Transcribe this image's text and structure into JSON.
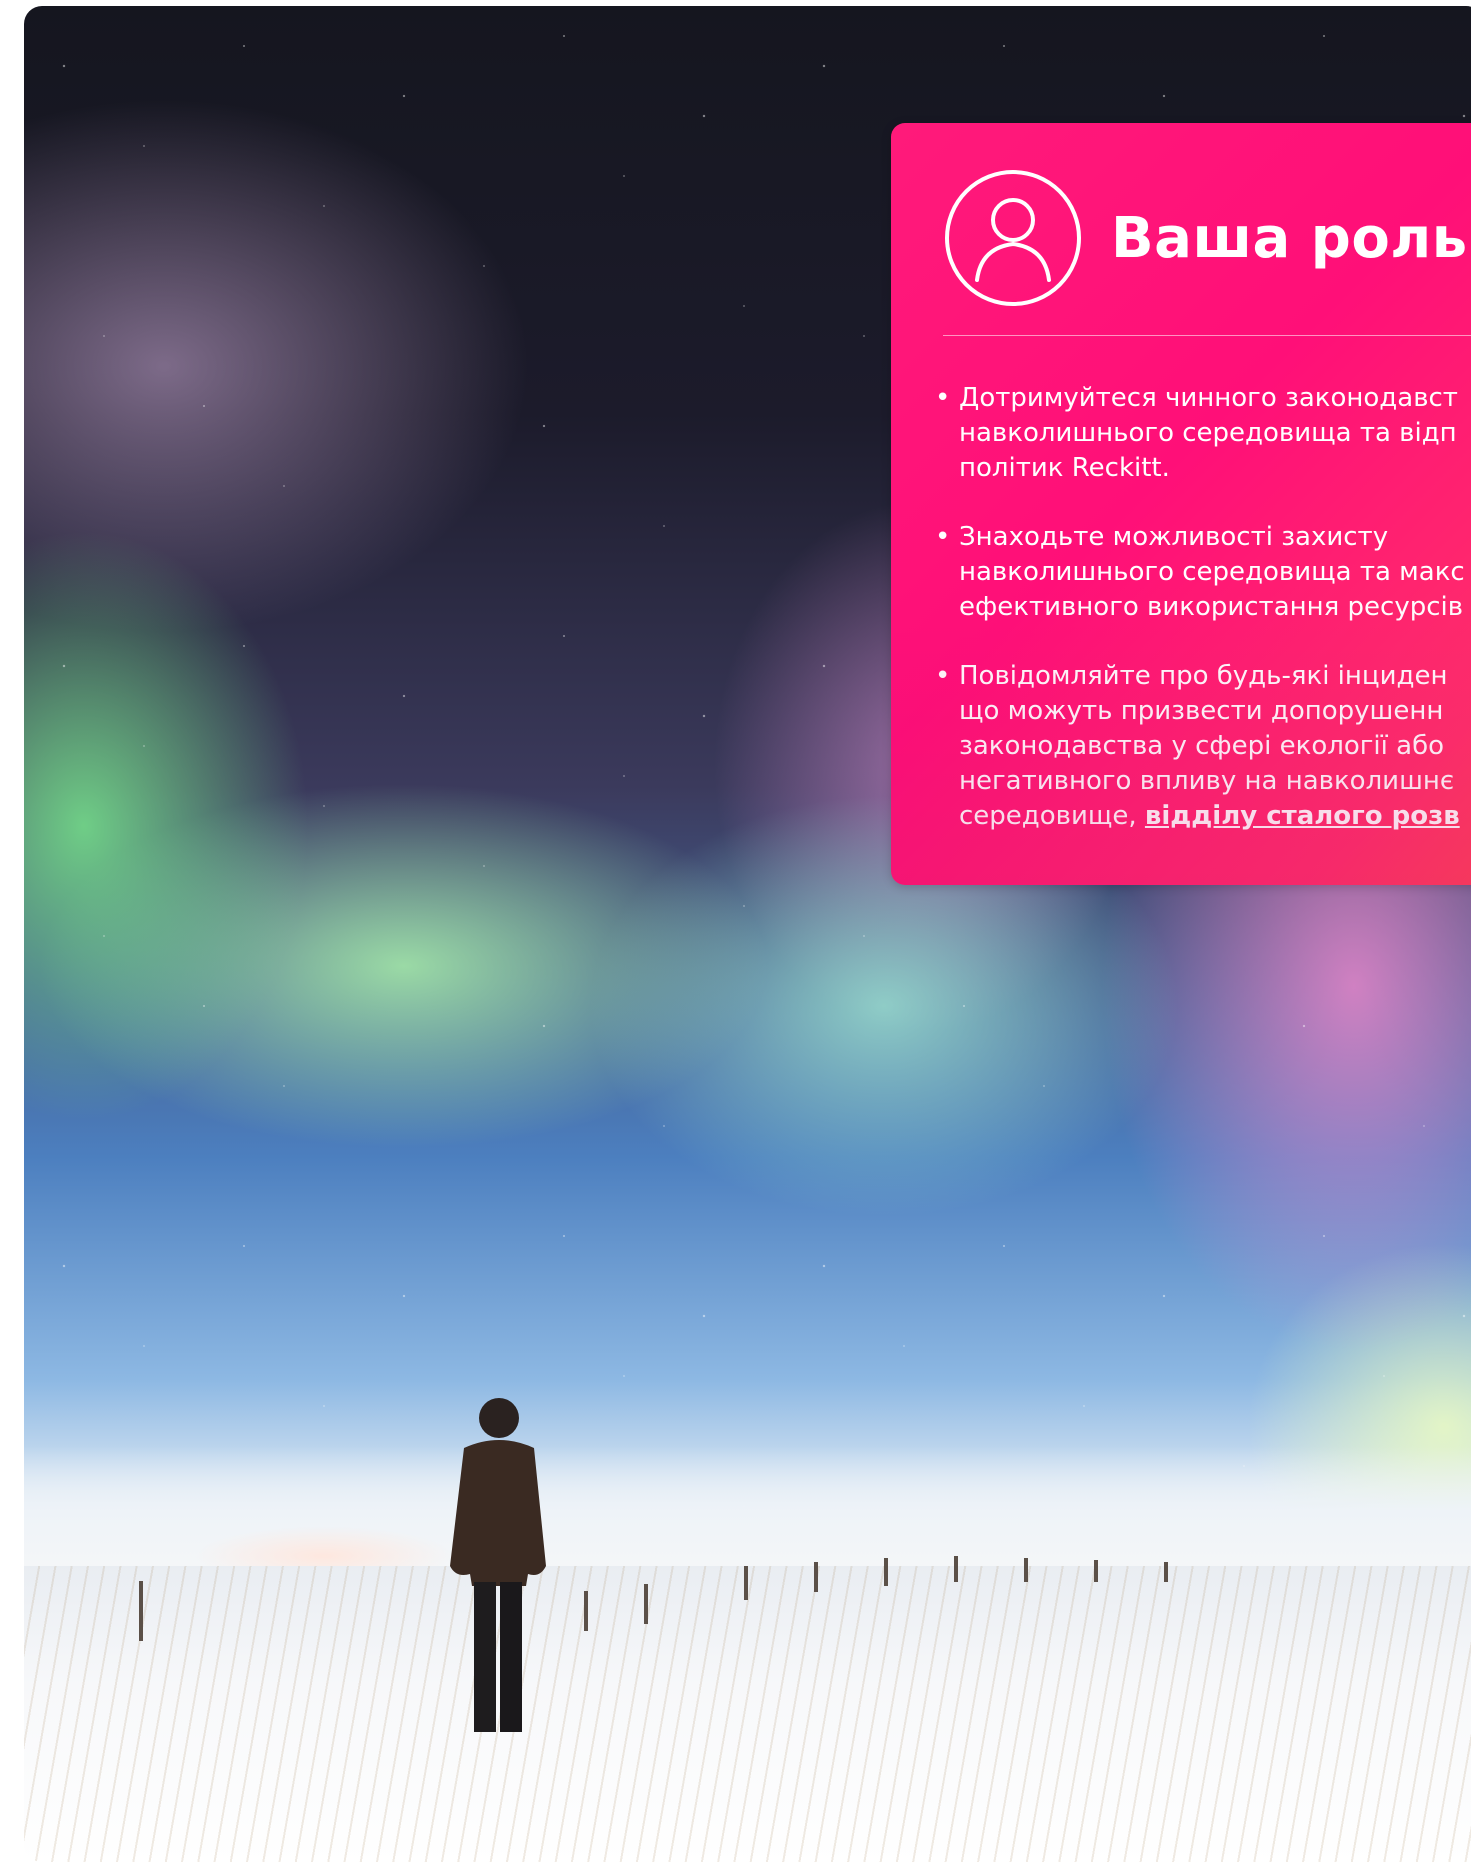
{
  "role_card": {
    "title": "Ваша роль",
    "icon": "user-outline-icon",
    "accent_color": "#ff0f78",
    "items": [
      {
        "lines": [
          "Дотримуйтеся чинного законодавст",
          "навколишнього середовища та відп",
          "політик Reckitt."
        ]
      },
      {
        "lines": [
          "Знаходьте можливості захисту",
          "навколишнього середовища та макс",
          "ефективного використання ресурсів"
        ]
      },
      {
        "lines": [
          "Повідомляйте про будь-які інциден",
          "що можуть призвести допорушенн",
          "законодавства у сфері екології або",
          "негативного впливу на навколишнє"
        ],
        "last_line_prefix": "середовище, ",
        "link_text": "відділу сталого розв"
      }
    ]
  },
  "background": {
    "scene": "aurora-landscape-photo"
  }
}
